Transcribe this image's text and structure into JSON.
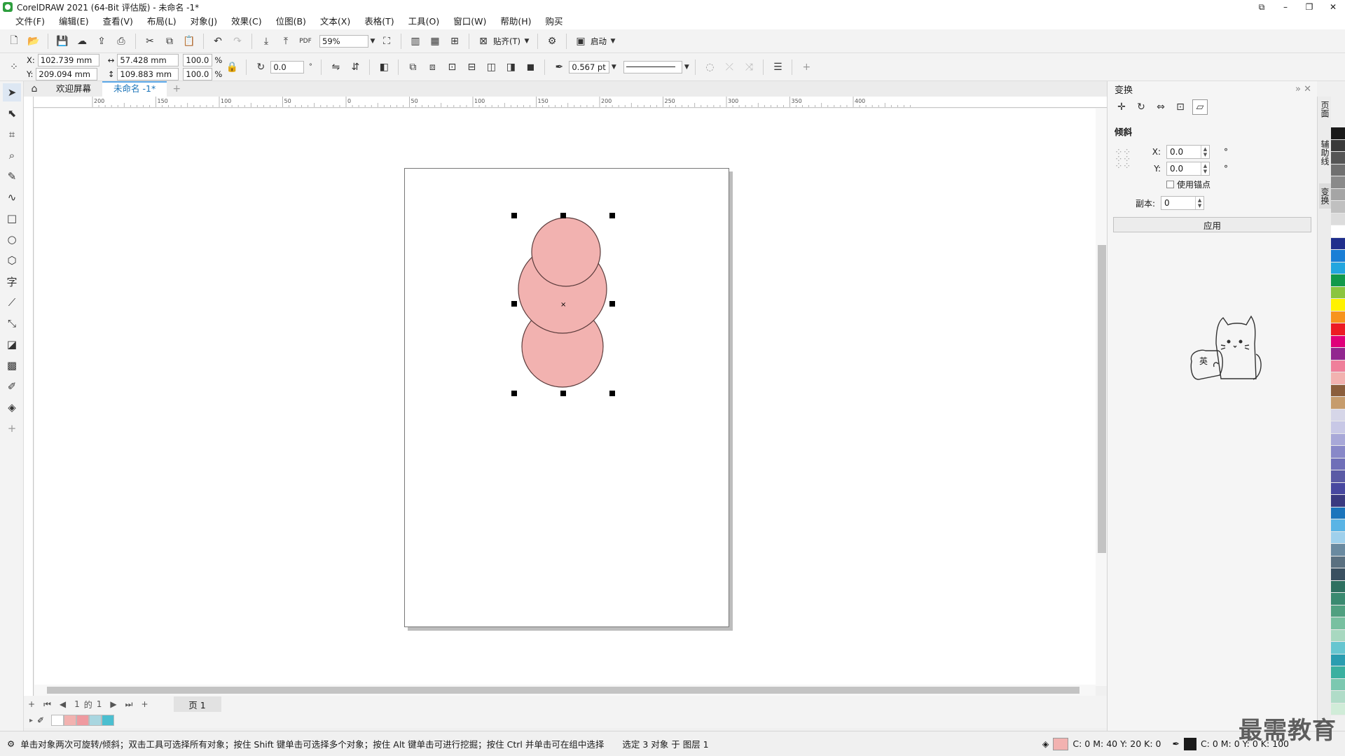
{
  "window": {
    "title": "CorelDRAW 2021 (64-Bit 评估版) - 未命名 -1*",
    "controls": [
      "⧉",
      "–",
      "❐",
      "✕"
    ]
  },
  "menu": [
    "文件(F)",
    "编辑(E)",
    "查看(V)",
    "布局(L)",
    "对象(J)",
    "效果(C)",
    "位图(B)",
    "文本(X)",
    "表格(T)",
    "工具(O)",
    "窗口(W)",
    "帮助(H)",
    "购买"
  ],
  "toolbar": {
    "zoom": "59%",
    "snap_label": "贴齐(T)",
    "launch_label": "启动"
  },
  "propbar": {
    "x_label": "X:",
    "y_label": "Y:",
    "x": "102.739 mm",
    "y": "209.094 mm",
    "width": "57.428 mm",
    "height": "109.883 mm",
    "scale_x": "100.0",
    "scale_y": "100.0",
    "percent": "%",
    "rotation": "0.0",
    "outline_width": "0.567 pt"
  },
  "tabs": {
    "welcome": "欢迎屏幕",
    "doc": "未命名 -1*"
  },
  "ruler": {
    "h_ticks": [
      "200",
      "150",
      "100",
      "50",
      "0",
      "50",
      "100",
      "150",
      "200",
      "250",
      "300",
      "350",
      "400"
    ]
  },
  "canvas": {
    "shape_fill": "#f2b2b0",
    "shape_stroke": "#5a3b3b",
    "center_mark": "×"
  },
  "pagenav": {
    "current": "1",
    "of_label": "的",
    "total": "1",
    "page_tab": "页 1"
  },
  "docker": {
    "title": "变换",
    "section": "倾斜",
    "x_label": "X:",
    "y_label": "Y:",
    "x_value": "0.0",
    "y_value": "0.0",
    "degree": "°",
    "use_anchor": "使用锚点",
    "copies_label": "副本:",
    "copies_value": "0",
    "apply": "应用",
    "ime_label": "英"
  },
  "side_tabs": [
    "页面",
    "辅助线",
    "变换"
  ],
  "palette_colors": [
    "#1a1a1a",
    "#3a3a3a",
    "#555",
    "#707070",
    "#8a8a8a",
    "#a5a5a5",
    "#c0c0c0",
    "#dcdcdc",
    "#ffffff",
    "#1f2e8c",
    "#1a7fd6",
    "#23a6df",
    "#12994b",
    "#8bc53f",
    "#fff200",
    "#f7941d",
    "#ed1c24",
    "#e0007a",
    "#92278f",
    "#ef7f9a",
    "#f2b2b0",
    "#8b5e3c",
    "#c69c6d",
    "#d6d6e8",
    "#c8c8e6",
    "#a8a8d8",
    "#8888c8",
    "#6f6fb8",
    "#5a5aa5",
    "#4848a0",
    "#3a3a80",
    "#1b75bc",
    "#5ab4e5",
    "#9fd0ec",
    "#6a8aa0",
    "#5a7080",
    "#3a5060",
    "#2e7060",
    "#3a8a70",
    "#50a080",
    "#78c0a0",
    "#a8d8c0",
    "#66c6d0",
    "#2a9db0",
    "#3ab0a0",
    "#7cc8b0",
    "#b0dcc8",
    "#d0ecd8"
  ],
  "doc_palette": [
    "#ffffff",
    "#f2b2b0",
    "#ef9aa0",
    "#a9d6e0",
    "#4bbfd0"
  ],
  "status": {
    "hint": "单击对象两次可旋转/倾斜；双击工具可选择所有对象；按住 Shift 键单击可选择多个对象；按住 Alt 键单击可进行挖掘；按住 Ctrl 并单击可在组中选择",
    "selection": "选定 3 对象 于 图层 1",
    "fill_info": "C: 0 M: 40 Y: 20 K: 0",
    "outline_info": "C: 0 M: 0 Y: 0 K: 100"
  },
  "watermark": "最需教育"
}
